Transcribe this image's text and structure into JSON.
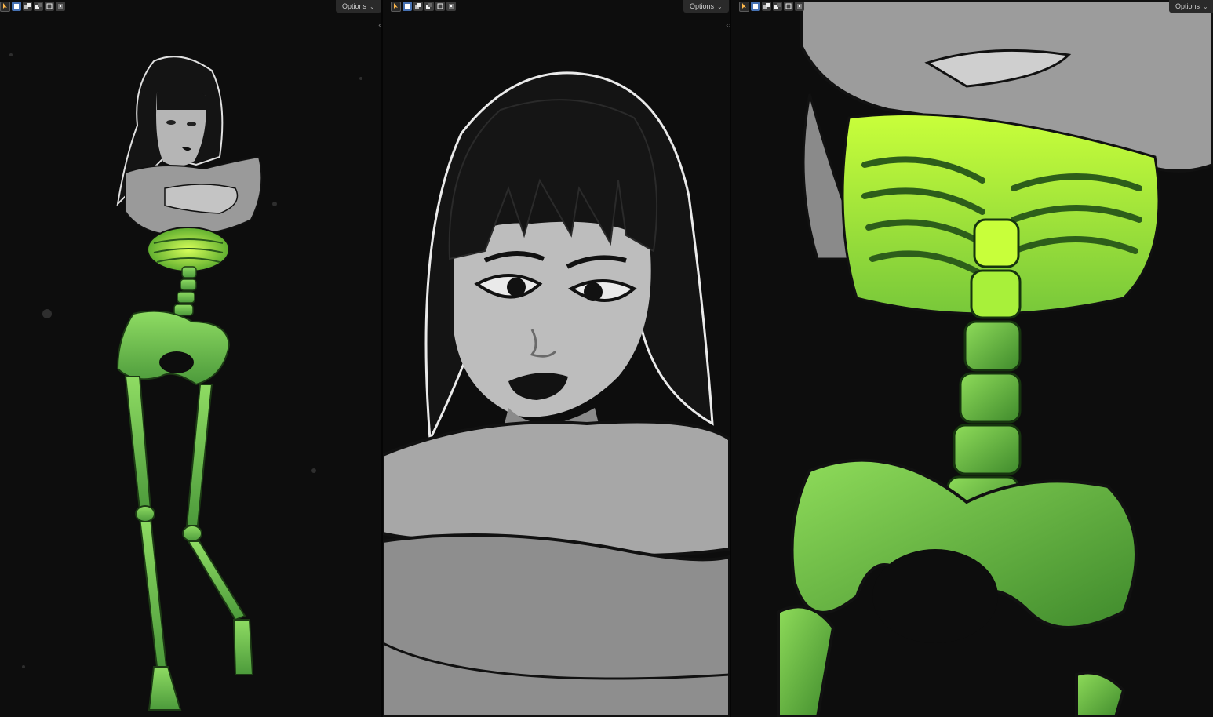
{
  "viewports": [
    {
      "options_label": "Options",
      "split_icon": "‹›"
    },
    {
      "options_label": "Options",
      "split_icon": "‹›"
    },
    {
      "options_label": "Options"
    }
  ],
  "icons": {
    "select": "select-tool-icon",
    "modes": [
      "mode-set-icon",
      "mode-add-icon",
      "mode-subtract-icon",
      "mode-invert-icon",
      "mode-intersect-icon"
    ]
  },
  "colors": {
    "background": "#0d0d0d",
    "bone_green": "#7ed65a",
    "glow_green": "#b8ff3a",
    "skin": "#9c9c9c",
    "hair": "#141414",
    "accent": "#4772b3"
  }
}
